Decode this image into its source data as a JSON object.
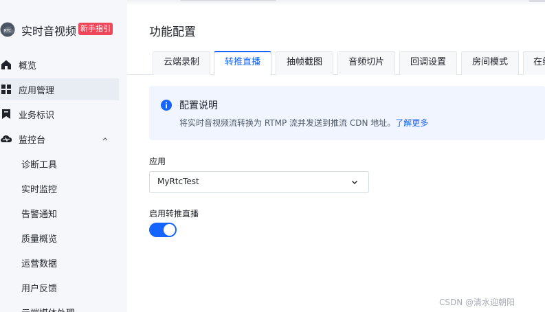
{
  "app": {
    "title": "实时音视频",
    "guide_badge": "新手指引",
    "logo_text": "RTC"
  },
  "sidebar": {
    "items": [
      {
        "label": "概览",
        "icon": "home-icon"
      },
      {
        "label": "应用管理",
        "icon": "grid-icon",
        "active": true
      },
      {
        "label": "业务标识",
        "icon": "bookmark-icon"
      },
      {
        "label": "监控台",
        "icon": "cloud-monitor-icon",
        "expanded": true
      }
    ],
    "sub_items": [
      {
        "label": "诊断工具"
      },
      {
        "label": "实时监控"
      },
      {
        "label": "告警通知"
      },
      {
        "label": "质量概览"
      },
      {
        "label": "运营数据"
      },
      {
        "label": "用户反馈"
      },
      {
        "label": "云端媒体处理"
      }
    ]
  },
  "main": {
    "page_title": "功能配置",
    "tabs": [
      {
        "label": "云端录制"
      },
      {
        "label": "转推直播",
        "active": true
      },
      {
        "label": "抽帧截图"
      },
      {
        "label": "音频切片"
      },
      {
        "label": "回调设置"
      },
      {
        "label": "房间模式"
      },
      {
        "label": "在线"
      }
    ],
    "info": {
      "title": "配置说明",
      "description": "将实时音视频流转换为 RTMP 流并发送到推流 CDN 地址。",
      "link": "了解更多"
    },
    "app_field": {
      "label": "应用",
      "value": "MyRtcTest"
    },
    "relay_field": {
      "label": "启用转推直播",
      "enabled": true
    }
  },
  "watermark": "CSDN @清水迎朝阳",
  "colors": {
    "accent": "#1664ff",
    "badge": "#f0465a",
    "sidebar_bg": "#f5f7fa",
    "info_bg": "#f0f5ff"
  }
}
